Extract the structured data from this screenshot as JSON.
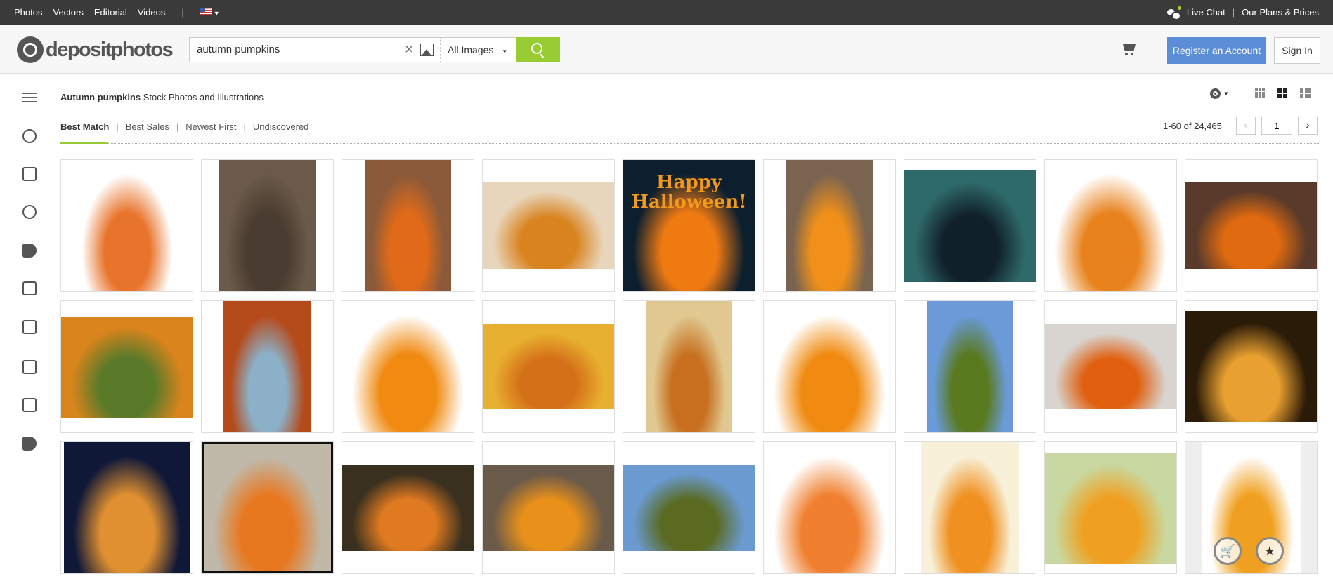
{
  "topbar": {
    "nav": [
      "Photos",
      "Vectors",
      "Editorial",
      "Videos"
    ],
    "live_chat": "Live Chat",
    "plans": "Our Plans & Prices",
    "divider": "|"
  },
  "header": {
    "logo": "depositphotos",
    "search_value": "autumn pumpkins",
    "search_placeholder": "",
    "filter": "All Images",
    "register": "Register an Account",
    "sign_in": "Sign In"
  },
  "sidebar": [
    "menu-icon",
    "trending-icon",
    "list-icon",
    "user-circle-icon",
    "tag-minus-icon",
    "frame-icon",
    "news-icon",
    "people-icon",
    "expand-icon",
    "paint-bucket-icon"
  ],
  "results": {
    "title_bold": "Autumn pumpkins",
    "title_rest": "Stock Photos and Illustrations",
    "sort": [
      "Best Match",
      "Best Sales",
      "Newest First",
      "Undiscovered"
    ],
    "count": "1-60 of 24,465",
    "page": "1"
  },
  "colors": {
    "accent": "#99cc33",
    "register": "#5b8ed6",
    "topbar": "#3a3a3a"
  },
  "tiles": [
    {
      "c": [
        "#fff",
        "#e8732a"
      ]
    },
    {
      "c": [
        "#6b5a4a",
        "#4a3c30"
      ]
    },
    {
      "c": [
        "#8a5a3a",
        "#e06a1a"
      ]
    },
    {
      "c": [
        "#e8d6bc",
        "#d9831f"
      ]
    },
    {
      "c": [
        "#0b1f2e",
        "#f07a12"
      ],
      "text": "Happy Halloween!"
    },
    {
      "c": [
        "#7a6450",
        "#f0901a"
      ]
    },
    {
      "c": [
        "#2f6a6a",
        "#10202a"
      ]
    },
    {
      "c": [
        "#fff",
        "#e8821c"
      ]
    },
    {
      "c": [
        "#5a3a2a",
        "#e06a10"
      ]
    },
    {
      "c": [
        "#d9841c",
        "#5a7a2a"
      ]
    },
    {
      "c": [
        "#b54a1a",
        "#8cb0c8"
      ]
    },
    {
      "c": [
        "#fff",
        "#f08a10"
      ]
    },
    {
      "c": [
        "#e8b030",
        "#d47018"
      ]
    },
    {
      "c": [
        "#e0c890",
        "#c87020"
      ]
    },
    {
      "c": [
        "#fff",
        "#f08a10"
      ]
    },
    {
      "c": [
        "#6a9ad8",
        "#5a7a20"
      ]
    },
    {
      "c": [
        "#d8d4d0",
        "#e06010"
      ]
    },
    {
      "c": [
        "#2a1a08",
        "#e8a030"
      ]
    },
    {
      "c": [
        "#101838",
        "#e09030"
      ]
    },
    {
      "c": [
        "#c0b8a8",
        "#e87820"
      ]
    },
    {
      "c": [
        "#3a3020",
        "#e07a20"
      ]
    },
    {
      "c": [
        "#6a5a4a",
        "#e8901a"
      ]
    },
    {
      "c": [
        "#6a9ad0",
        "#5a6a20"
      ]
    },
    {
      "c": [
        "#fff",
        "#f08030"
      ]
    },
    {
      "c": [
        "#f8f0d8",
        "#f09020"
      ]
    },
    {
      "c": [
        "#c8d8a0",
        "#f0a020"
      ]
    },
    {
      "c": [
        "#fff",
        "#f0a020"
      ]
    }
  ]
}
